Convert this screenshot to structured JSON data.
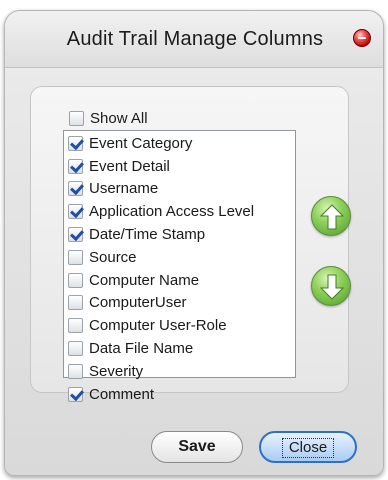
{
  "window": {
    "title": "Audit Trail Manage Columns"
  },
  "show_all": {
    "label": "Show All",
    "checked": false
  },
  "columns": [
    {
      "label": "Event Category",
      "checked": true
    },
    {
      "label": "Event Detail",
      "checked": true
    },
    {
      "label": "Username",
      "checked": true
    },
    {
      "label": "Application Access Level",
      "checked": true
    },
    {
      "label": "Date/Time Stamp",
      "checked": true
    },
    {
      "label": "Source",
      "checked": false
    },
    {
      "label": "Computer Name",
      "checked": false
    },
    {
      "label": "ComputerUser",
      "checked": false
    },
    {
      "label": "Computer User-Role",
      "checked": false
    },
    {
      "label": "Data File Name",
      "checked": false
    },
    {
      "label": "Severity",
      "checked": false
    },
    {
      "label": "Comment",
      "checked": true
    }
  ],
  "buttons": {
    "save_label": "Save",
    "close_label": "Close"
  },
  "icons": {
    "move_up": "arrow-up-icon",
    "move_down": "arrow-down-icon",
    "window_close": "close-icon"
  },
  "colors": {
    "arrow_green": "#4f9d2a",
    "close_red": "#b40000",
    "check_blue": "#1f4fa6"
  }
}
